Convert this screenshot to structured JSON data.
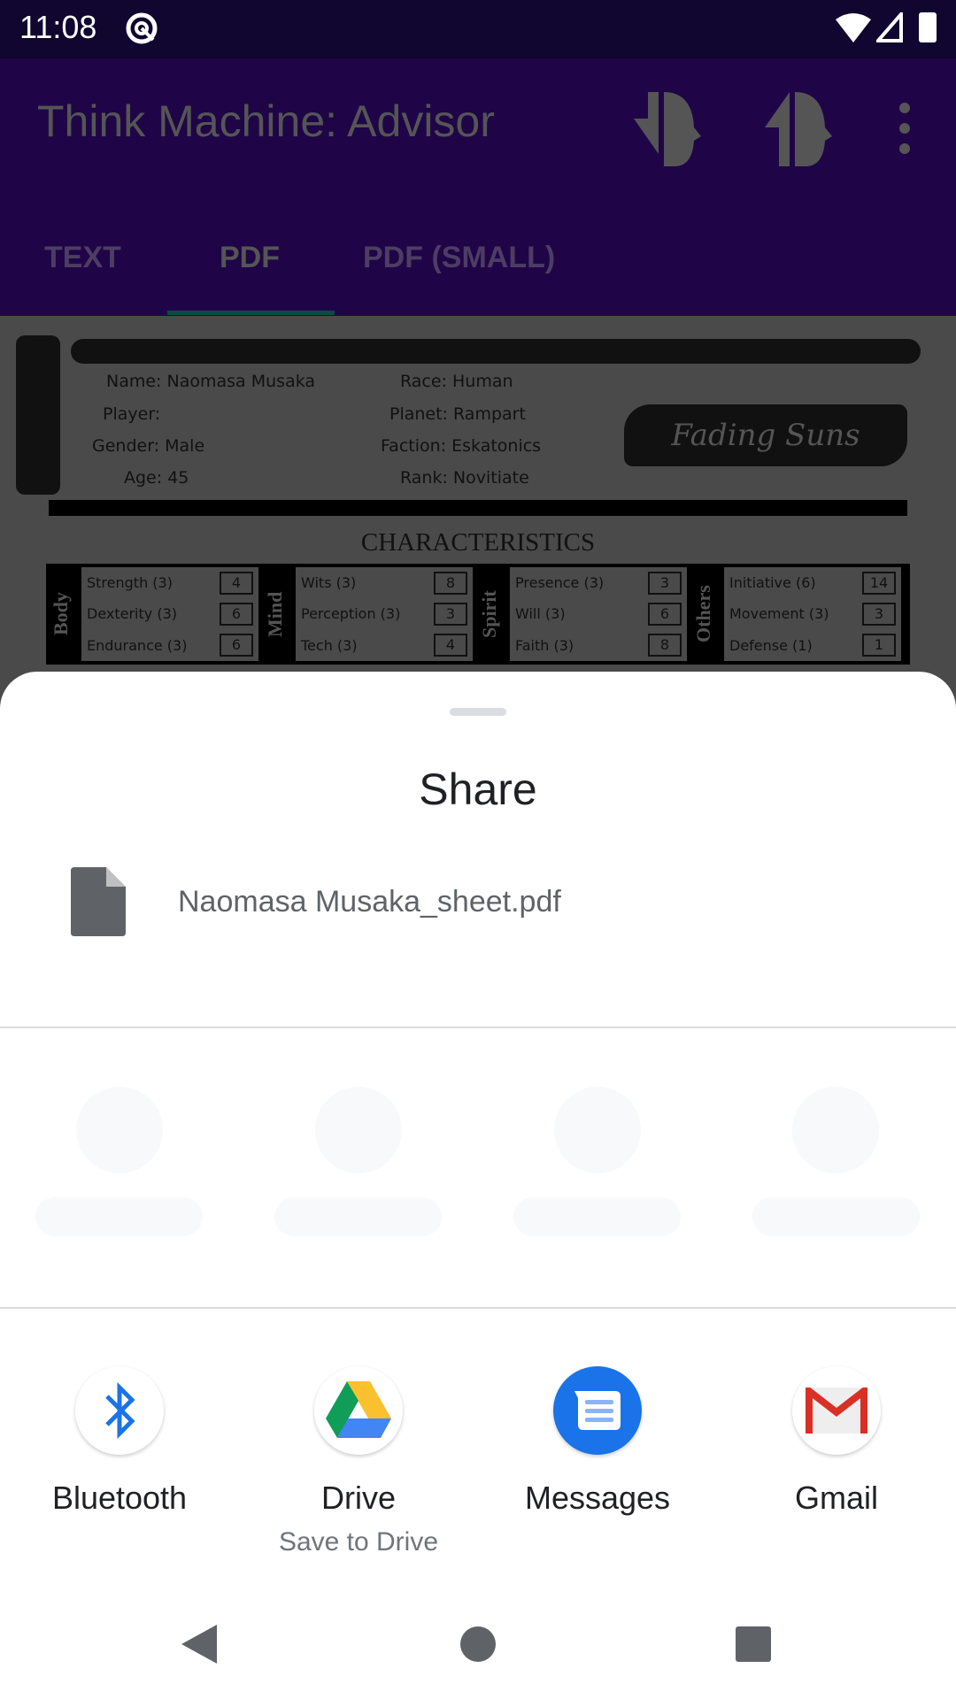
{
  "status_bar": {
    "time": "11:08",
    "icons": [
      "at-sign-icon",
      "wifi-icon",
      "signal-icon",
      "battery-icon"
    ]
  },
  "app_bar": {
    "title": "Think Machine: Advisor",
    "actions": [
      "export-head-icon",
      "import-head-icon",
      "more-vert-icon"
    ]
  },
  "tabs": [
    {
      "label": "TEXT"
    },
    {
      "label": "PDF",
      "selected": true
    },
    {
      "label": "PDF (SMALL)"
    }
  ],
  "pdf": {
    "fields": [
      {
        "label": "Name:",
        "value": "Naomasa Musaka"
      },
      {
        "label": "Player:",
        "value": ""
      },
      {
        "label": "Gender:",
        "value": "Male"
      },
      {
        "label": "Age:",
        "value": "45"
      },
      {
        "label": "Race:",
        "value": "Human"
      },
      {
        "label": "Planet:",
        "value": "Rampart"
      },
      {
        "label": "Faction:",
        "value": "Eskatonics"
      },
      {
        "label": "Rank:",
        "value": "Novitiate"
      }
    ],
    "logo_text": "Fading Suns",
    "section_title": "CHARACTERISTICS",
    "groups": [
      {
        "name": "Body",
        "stats": [
          {
            "label": "Strength (3)",
            "value": "4"
          },
          {
            "label": "Dexterity (3)",
            "value": "6"
          },
          {
            "label": "Endurance (3)",
            "value": "6"
          }
        ]
      },
      {
        "name": "Mind",
        "stats": [
          {
            "label": "Wits (3)",
            "value": "8"
          },
          {
            "label": "Perception (3)",
            "value": "3"
          },
          {
            "label": "Tech (3)",
            "value": "4"
          }
        ]
      },
      {
        "name": "Spirit",
        "stats": [
          {
            "label": "Presence (3)",
            "value": "3"
          },
          {
            "label": "Will (3)",
            "value": "6"
          },
          {
            "label": "Faith (3)",
            "value": "8"
          }
        ]
      },
      {
        "name": "Others",
        "stats": [
          {
            "label": "Initiative (6)",
            "value": "14"
          },
          {
            "label": "Movement (3)",
            "value": "3"
          },
          {
            "label": "Defense (1)",
            "value": "1"
          }
        ]
      }
    ]
  },
  "share_sheet": {
    "title": "Share",
    "file_name": "Naomasa Musaka_sheet.pdf",
    "apps": [
      {
        "label": "Bluetooth",
        "sub": ""
      },
      {
        "label": "Drive",
        "sub": "Save to Drive"
      },
      {
        "label": "Messages",
        "sub": ""
      },
      {
        "label": "Gmail",
        "sub": ""
      }
    ]
  },
  "colors": {
    "app_bar": "#1f0547",
    "tab_indicator": "#0b4a42",
    "messages_blue": "#1a73e8"
  }
}
